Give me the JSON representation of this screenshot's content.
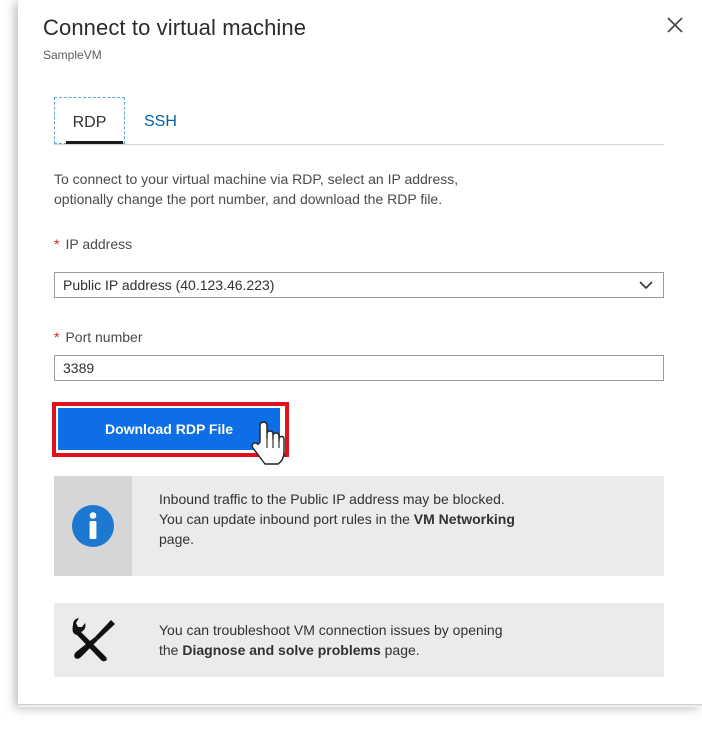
{
  "dialog": {
    "title": "Connect to virtual machine",
    "subtitle": "SampleVM",
    "close_icon": "close-icon"
  },
  "tabs": [
    {
      "label": "RDP",
      "active": true
    },
    {
      "label": "SSH",
      "active": false
    }
  ],
  "description": {
    "line1": "To connect to your virtual machine via RDP, select an IP address,",
    "line2": "optionally change the port number, and download the RDP file."
  },
  "ip_address": {
    "required_mark": "*",
    "label": "IP address",
    "selected": "Public IP address (40.123.46.223)",
    "icon": "chevron-down-icon"
  },
  "port": {
    "required_mark": "*",
    "label": "Port number",
    "value": "3389"
  },
  "download_button": {
    "label": "Download RDP File",
    "color": "#0d6ee6",
    "highlight_color": "#e0101d",
    "cursor_icon": "hand-pointer-icon"
  },
  "info_box": {
    "icon": "info-icon",
    "line1": "Inbound traffic to the Public IP address may be blocked.",
    "line2_prefix": "You can update inbound port rules in the ",
    "line2_link": "VM Networking",
    "line3": "page."
  },
  "troubleshoot_box": {
    "icon": "tools-icon",
    "line1": "You can troubleshoot VM connection issues by opening",
    "line2_prefix": "the ",
    "line2_bold": "Diagnose and solve problems",
    "line2_suffix": " page."
  }
}
